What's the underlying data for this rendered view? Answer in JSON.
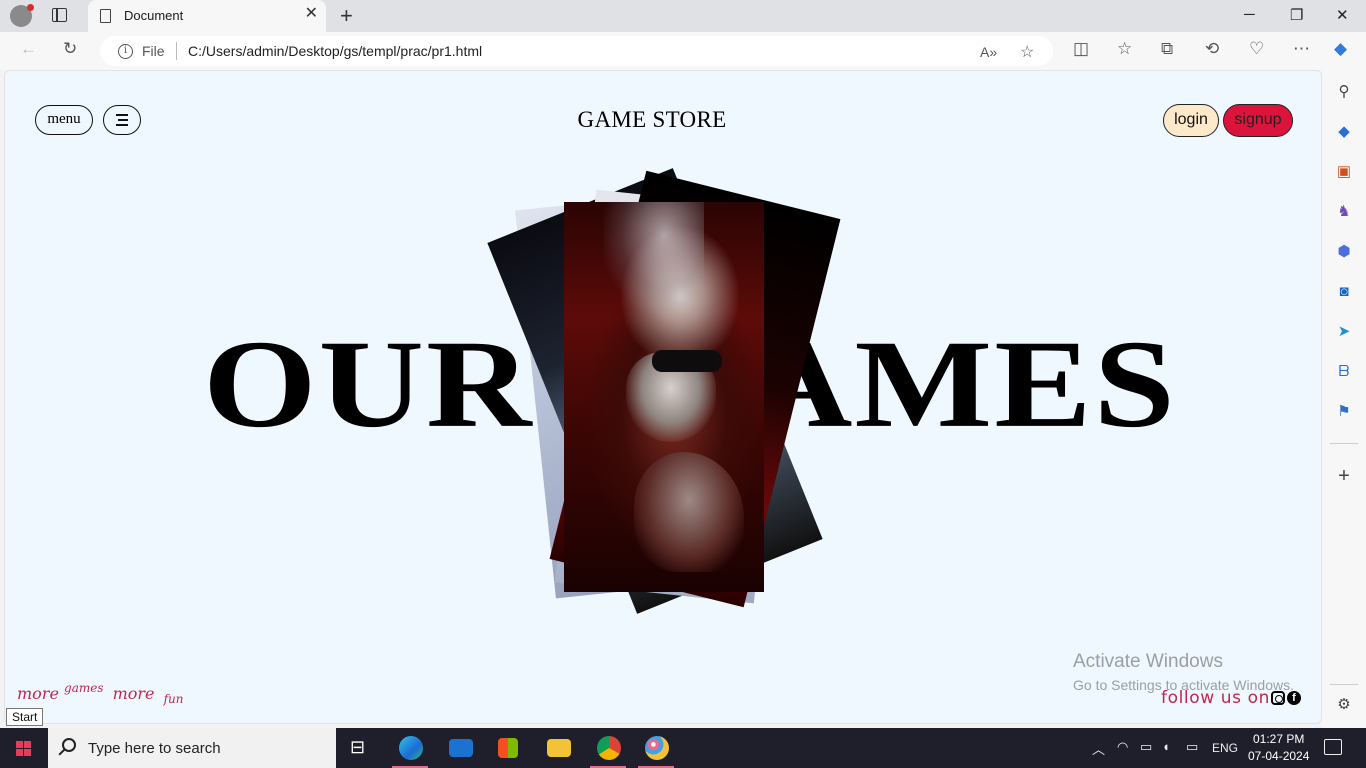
{
  "browser": {
    "tab_title": "Document",
    "new_tab_symbol": "+",
    "address_label": "File",
    "url": "C:/Users/admin/Desktop/gs/templ/prac/pr1.html"
  },
  "page": {
    "menu_label": "menu",
    "store_title": "GAME STORE",
    "login_label": "login",
    "signup_label": "signup",
    "hero_left": "OUR",
    "hero_right": "AMES",
    "tagline": {
      "word1": "more",
      "word2": "games",
      "word3": "more",
      "word4": "fun"
    },
    "follow_text": "follow us on",
    "social_icons": [
      "instagram-icon",
      "facebook-icon"
    ],
    "accent_color": "#dc143c",
    "background_color": "#eff7ff"
  },
  "watermark": {
    "line1": "Activate Windows",
    "line2": "Go to Settings to activate Windows."
  },
  "tooltip": {
    "start": "Start"
  },
  "taskbar": {
    "search_placeholder": "Type here to search",
    "language": "ENG",
    "time": "01:27 PM",
    "date": "07-04-2024"
  }
}
